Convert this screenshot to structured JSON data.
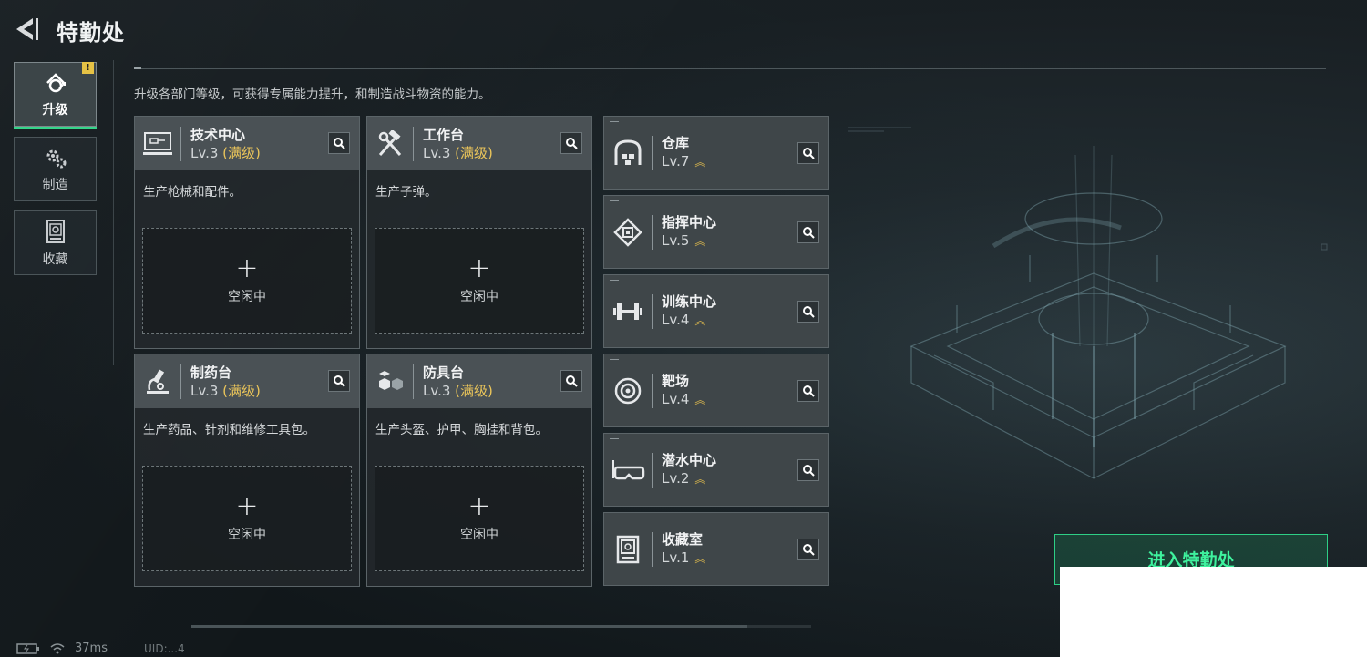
{
  "header": {
    "title": "特勤处"
  },
  "tabs": [
    {
      "label": "升级",
      "icon": "arrow-up-gear-icon",
      "active": true,
      "badge": "!"
    },
    {
      "label": "制造",
      "icon": "gears-icon",
      "active": false
    },
    {
      "label": "收藏",
      "icon": "vault-icon",
      "active": false
    }
  ],
  "intro": "升级各部门等级，可获得专属能力提升，和制造战斗物资的能力。",
  "workshops": [
    {
      "name": "技术中心",
      "level": "Lv.3",
      "max": "(满级)",
      "desc": "生产枪械和配件。",
      "slot": "空闲中",
      "icon": "tech-center-icon"
    },
    {
      "name": "工作台",
      "level": "Lv.3",
      "max": "(满级)",
      "desc": "生产子弹。",
      "slot": "空闲中",
      "icon": "hammer-wrench-icon"
    },
    {
      "name": "制药台",
      "level": "Lv.3",
      "max": "(满级)",
      "desc": "生产药品、针剂和维修工具包。",
      "slot": "空闲中",
      "icon": "microscope-icon"
    },
    {
      "name": "防具台",
      "level": "Lv.3",
      "max": "(满级)",
      "desc": "生产头盔、护甲、胸挂和背包。",
      "slot": "空闲中",
      "icon": "armor-blocks-icon"
    }
  ],
  "facilities": [
    {
      "name": "仓库",
      "level": "Lv.7",
      "icon": "warehouse-icon"
    },
    {
      "name": "指挥中心",
      "level": "Lv.5",
      "icon": "command-chip-icon"
    },
    {
      "name": "训练中心",
      "level": "Lv.4",
      "icon": "dumbbell-icon"
    },
    {
      "name": "靶场",
      "level": "Lv.4",
      "icon": "target-icon"
    },
    {
      "name": "潜水中心",
      "level": "Lv.2",
      "icon": "diving-goggles-icon"
    },
    {
      "name": "收藏室",
      "level": "Lv.1",
      "icon": "collection-case-icon"
    }
  ],
  "enter_button": "进入特勤处",
  "status": {
    "ping": "37ms",
    "uid": "UID:...4"
  },
  "colors": {
    "accent": "#35d48a",
    "max_level": "#e9c45a",
    "enter": "#3ef29e"
  }
}
